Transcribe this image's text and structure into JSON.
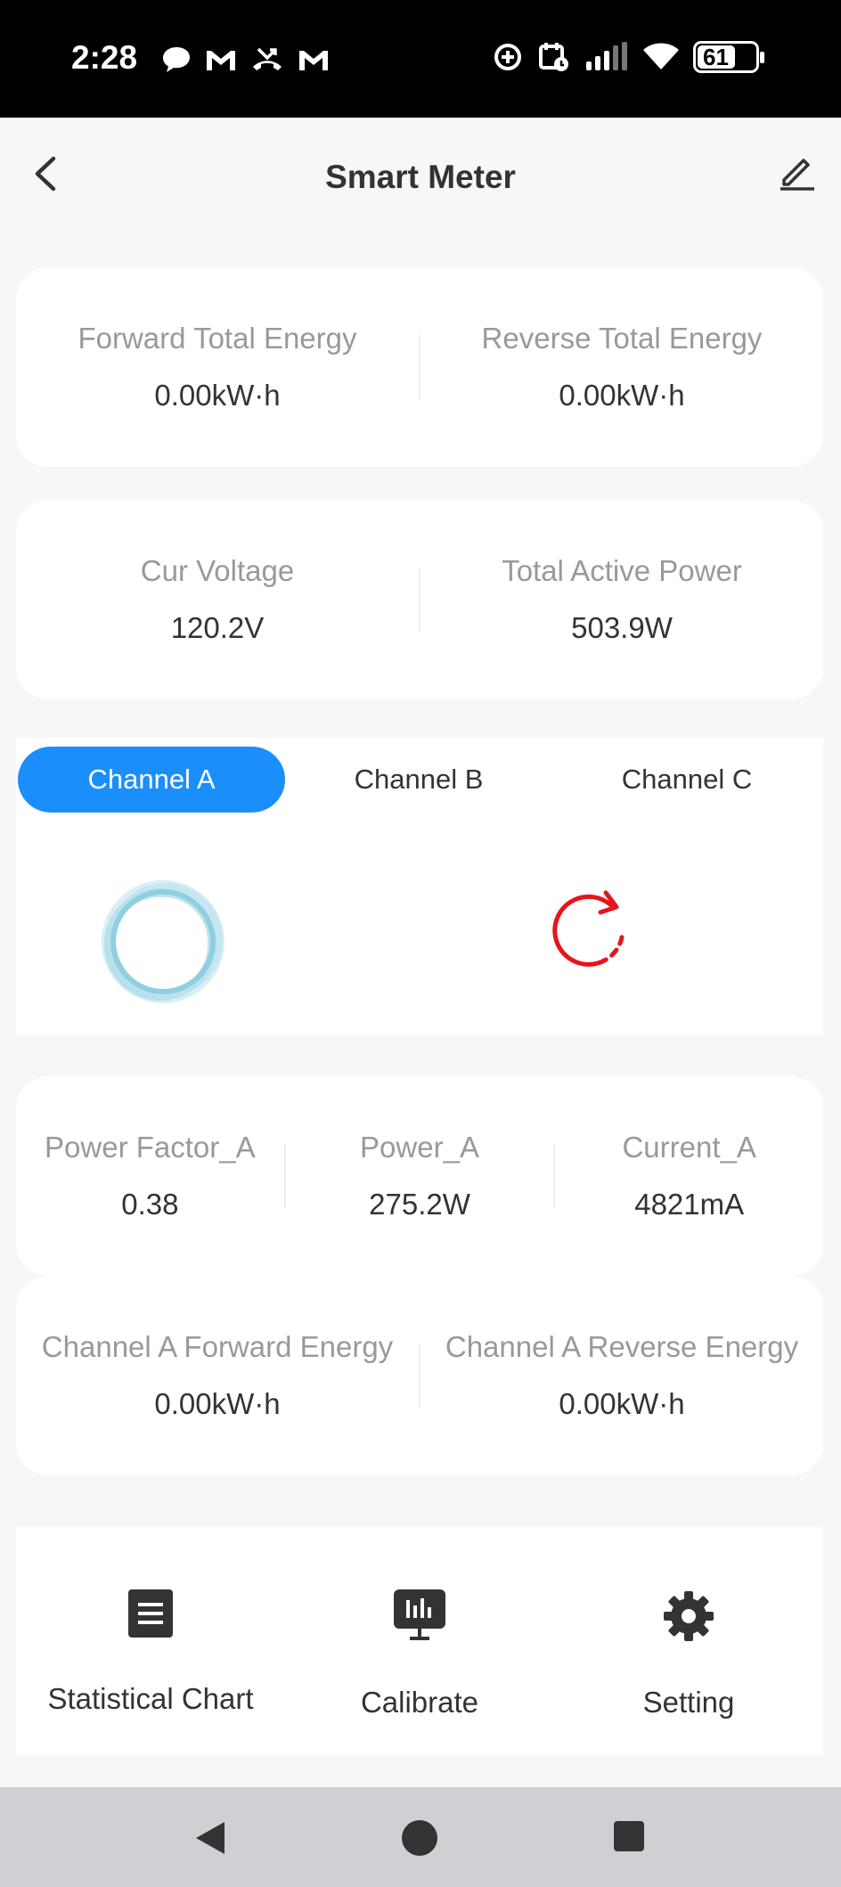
{
  "status_bar": {
    "time": "2:28",
    "battery_level": "61",
    "left_icons": [
      "chat-bubble-icon",
      "gmail-icon",
      "missed-call-icon",
      "gmail-icon"
    ],
    "right_icons": [
      "data-saver-icon",
      "calendar-alarm-icon",
      "signal-icon",
      "wifi-icon",
      "battery-icon"
    ]
  },
  "header": {
    "title": "Smart Meter"
  },
  "energy_totals": {
    "forward_label": "Forward Total Energy",
    "forward_value": "0.00kW·h",
    "reverse_label": "Reverse Total Energy",
    "reverse_value": "0.00kW·h"
  },
  "live": {
    "voltage_label": "Cur Voltage",
    "voltage_value": "120.2V",
    "power_label": "Total Active Power",
    "power_value": "503.9W"
  },
  "channel_tabs": {
    "a": "Channel A",
    "b": "Channel B",
    "c": "Channel C",
    "active": "Channel A",
    "active_color": "#1a8ffc"
  },
  "channel_metrics": {
    "pf_label": "Power Factor_A",
    "pf_value": "0.38",
    "power_label": "Power_A",
    "power_value": "275.2W",
    "current_label": "Current_A",
    "current_value": "4821mA"
  },
  "channel_energy": {
    "forward_label": "Channel A Forward Energy",
    "forward_value": "0.00kW·h",
    "reverse_label": "Channel A Reverse Energy",
    "reverse_value": "0.00kW·h"
  },
  "actions": {
    "chart": "Statistical Chart",
    "calibrate": "Calibrate",
    "setting": "Setting"
  },
  "colors": {
    "accent": "#1a8ffc",
    "ring": "#8fcfe0",
    "refresh": "#e8141b"
  }
}
